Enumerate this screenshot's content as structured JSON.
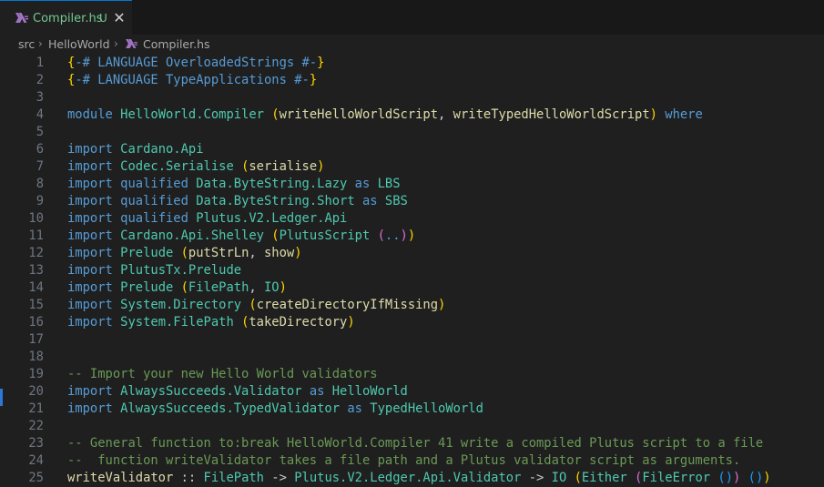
{
  "tab": {
    "filename": "Compiler.hs",
    "status": "U",
    "close_glyph": "✕"
  },
  "breadcrumb": {
    "parts": [
      "src",
      "HelloWorld",
      "Compiler.hs"
    ],
    "separator": "›"
  },
  "colors": {
    "keyword": "#569cd6",
    "module": "#4ec9b0",
    "pragma": "#569cd6",
    "comment": "#6a9955",
    "ident": "#dcdcaa",
    "paren": "#ffd700",
    "paren2": "#da70d6",
    "paren3": "#179fff",
    "var": "#9cdcfe",
    "plain": "#cccccc",
    "hs_icon": "#a074c4"
  },
  "lines": [
    {
      "n": "1",
      "tokens": [
        [
          "paren",
          "{"
        ],
        [
          "keyword",
          "-# LANGUAGE OverloadedStrings #-"
        ],
        [
          "paren",
          "}"
        ]
      ]
    },
    {
      "n": "2",
      "tokens": [
        [
          "paren",
          "{"
        ],
        [
          "keyword",
          "-# LANGUAGE TypeApplications #-"
        ],
        [
          "paren",
          "}"
        ]
      ]
    },
    {
      "n": "3",
      "tokens": []
    },
    {
      "n": "4",
      "tokens": [
        [
          "keyword",
          "module "
        ],
        [
          "module",
          "HelloWorld.Compiler "
        ],
        [
          "paren",
          "("
        ],
        [
          "ident",
          "writeHelloWorldScript"
        ],
        [
          "plain",
          ", "
        ],
        [
          "ident",
          "writeTypedHelloWorldScript"
        ],
        [
          "paren",
          ")"
        ],
        [
          "plain",
          " "
        ],
        [
          "keyword",
          "where"
        ]
      ]
    },
    {
      "n": "5",
      "tokens": []
    },
    {
      "n": "6",
      "tokens": [
        [
          "keyword",
          "import "
        ],
        [
          "module",
          "Cardano.Api"
        ]
      ]
    },
    {
      "n": "7",
      "tokens": [
        [
          "keyword",
          "import "
        ],
        [
          "module",
          "Codec.Serialise "
        ],
        [
          "paren",
          "("
        ],
        [
          "ident",
          "serialise"
        ],
        [
          "paren",
          ")"
        ]
      ]
    },
    {
      "n": "8",
      "tokens": [
        [
          "keyword",
          "import "
        ],
        [
          "keyword",
          "qualified "
        ],
        [
          "module",
          "Data.ByteString.Lazy "
        ],
        [
          "keyword",
          "as "
        ],
        [
          "module",
          "LBS"
        ]
      ]
    },
    {
      "n": "9",
      "tokens": [
        [
          "keyword",
          "import "
        ],
        [
          "keyword",
          "qualified "
        ],
        [
          "module",
          "Data.ByteString.Short "
        ],
        [
          "keyword",
          "as "
        ],
        [
          "module",
          "SBS"
        ]
      ]
    },
    {
      "n": "10",
      "tokens": [
        [
          "keyword",
          "import "
        ],
        [
          "keyword",
          "qualified "
        ],
        [
          "module",
          "Plutus.V2.Ledger.Api"
        ]
      ]
    },
    {
      "n": "11",
      "tokens": [
        [
          "keyword",
          "import "
        ],
        [
          "module",
          "Cardano.Api.Shelley "
        ],
        [
          "paren",
          "("
        ],
        [
          "module",
          "PlutusScript "
        ],
        [
          "paren2",
          "("
        ],
        [
          "keyword",
          ".."
        ],
        [
          "paren2",
          ")"
        ],
        [
          "paren",
          ")"
        ]
      ]
    },
    {
      "n": "12",
      "tokens": [
        [
          "keyword",
          "import "
        ],
        [
          "module",
          "Prelude "
        ],
        [
          "paren",
          "("
        ],
        [
          "ident",
          "putStrLn"
        ],
        [
          "plain",
          ", "
        ],
        [
          "ident",
          "show"
        ],
        [
          "paren",
          ")"
        ]
      ]
    },
    {
      "n": "13",
      "tokens": [
        [
          "keyword",
          "import "
        ],
        [
          "module",
          "PlutusTx.Prelude"
        ]
      ]
    },
    {
      "n": "14",
      "tokens": [
        [
          "keyword",
          "import "
        ],
        [
          "module",
          "Prelude "
        ],
        [
          "paren",
          "("
        ],
        [
          "module",
          "FilePath"
        ],
        [
          "plain",
          ", "
        ],
        [
          "module",
          "IO"
        ],
        [
          "paren",
          ")"
        ]
      ]
    },
    {
      "n": "15",
      "tokens": [
        [
          "keyword",
          "import "
        ],
        [
          "module",
          "System.Directory "
        ],
        [
          "paren",
          "("
        ],
        [
          "ident",
          "createDirectoryIfMissing"
        ],
        [
          "paren",
          ")"
        ]
      ]
    },
    {
      "n": "16",
      "tokens": [
        [
          "keyword",
          "import "
        ],
        [
          "module",
          "System.FilePath "
        ],
        [
          "paren",
          "("
        ],
        [
          "ident",
          "takeDirectory"
        ],
        [
          "paren",
          ")"
        ]
      ]
    },
    {
      "n": "17",
      "tokens": []
    },
    {
      "n": "18",
      "tokens": []
    },
    {
      "n": "19",
      "tokens": [
        [
          "comment",
          "-- Import your new Hello World validators"
        ]
      ]
    },
    {
      "n": "20",
      "tokens": [
        [
          "keyword",
          "import "
        ],
        [
          "module",
          "AlwaysSucceeds.Validator "
        ],
        [
          "keyword",
          "as "
        ],
        [
          "module",
          "HelloWorld"
        ]
      ]
    },
    {
      "n": "21",
      "tokens": [
        [
          "keyword",
          "import "
        ],
        [
          "module",
          "AlwaysSucceeds.TypedValidator "
        ],
        [
          "keyword",
          "as "
        ],
        [
          "module",
          "TypedHelloWorld"
        ]
      ]
    },
    {
      "n": "22",
      "tokens": []
    },
    {
      "n": "23",
      "tokens": [
        [
          "comment",
          "-- General function to:break HelloWorld.Compiler 41 write a compiled Plutus script to a file"
        ]
      ]
    },
    {
      "n": "24",
      "tokens": [
        [
          "comment",
          "--  function writeValidator takes a file path and a Plutus validator script as arguments."
        ]
      ]
    },
    {
      "n": "25",
      "tokens": [
        [
          "ident",
          "writeValidator "
        ],
        [
          "plain",
          ":: "
        ],
        [
          "module",
          "FilePath "
        ],
        [
          "plain",
          "-> "
        ],
        [
          "module",
          "Plutus.V2.Ledger.Api.Validator "
        ],
        [
          "plain",
          "-> "
        ],
        [
          "module",
          "IO "
        ],
        [
          "paren",
          "("
        ],
        [
          "module",
          "Either "
        ],
        [
          "paren2",
          "("
        ],
        [
          "module",
          "FileError "
        ],
        [
          "paren3",
          "()"
        ],
        [
          "paren2",
          ")"
        ],
        [
          "plain",
          " "
        ],
        [
          "paren3",
          "()"
        ],
        [
          "paren",
          ")"
        ]
      ]
    }
  ]
}
